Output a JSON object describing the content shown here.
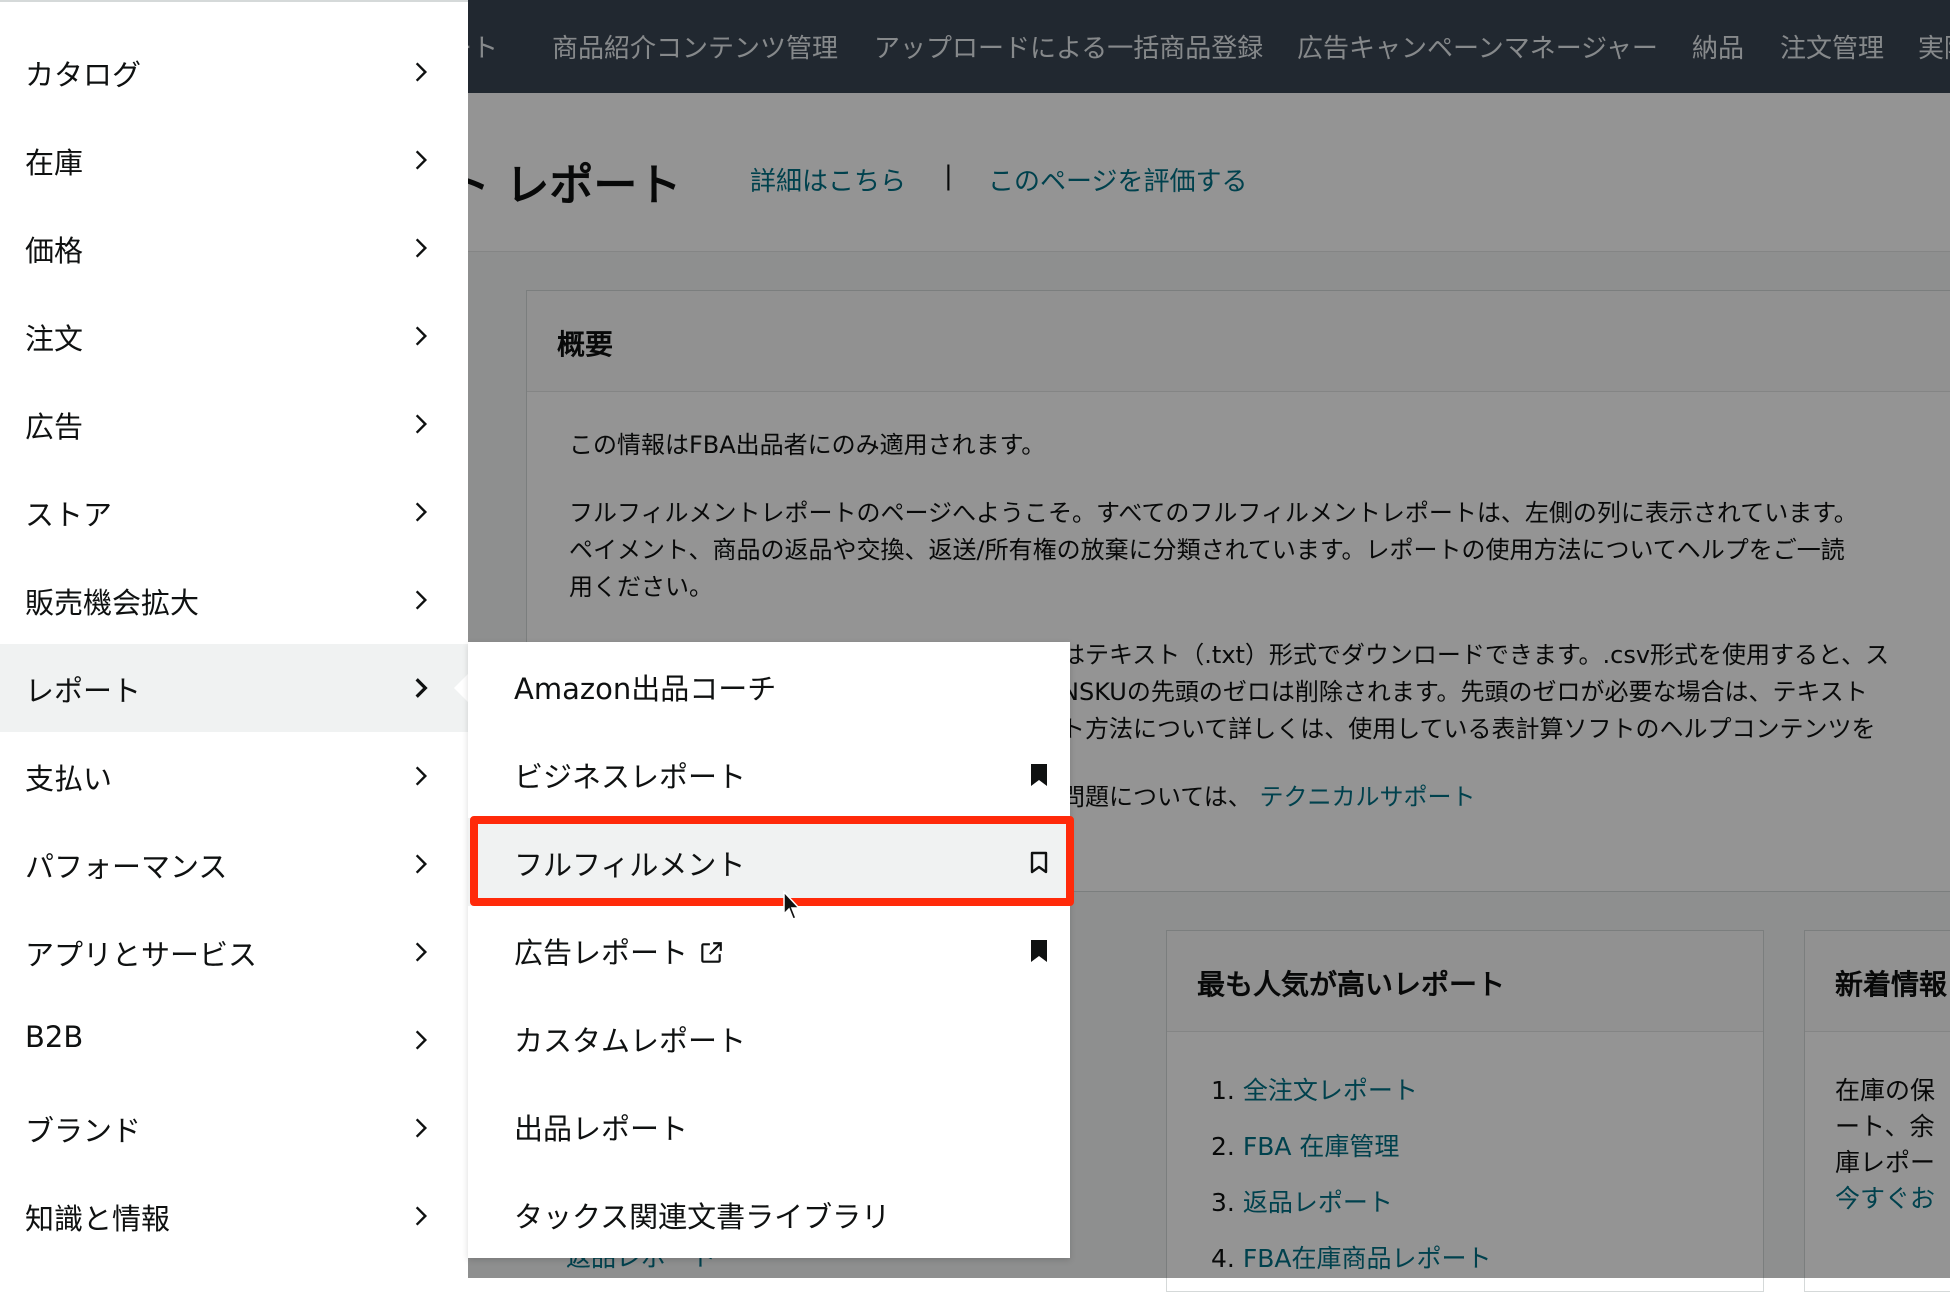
{
  "topnav": {
    "items": [
      "ート",
      "商品紹介コンテンツ管理",
      "アップロードによる一括商品登録",
      "広告キャンペーンマネージャー",
      "納品",
      "注文管理",
      "実際"
    ]
  },
  "header": {
    "title": "ト レポート",
    "learn_more": "詳細はこちら",
    "separator": "|",
    "rate_page": "このページを評価する"
  },
  "overview": {
    "title": "概要",
    "lines": [
      "この情報はFBA出品者にのみ適用されます。",
      "フルフィルメントレポートのページへようこそ。すべてのフルフィルメントレポートは、左側の列に表示されています。",
      "ペイメント、商品の返品や交換、返送/所有権の放棄に分類されています。レポートの使用方法についてヘルプをご一読",
      "用ください。",
      "はテキスト（.txt）形式でダウンロードできます。.csv形式を使用すると、ス",
      "NSKUの先頭のゼロは削除されます。先頭のゼロが必要な場合は、テキスト",
      "ト方法について詳しくは、使用している表計算ソフトのヘルプコンテンツを",
      "問題については、"
    ],
    "tech_support": "テクニカルサポート"
  },
  "popular": {
    "title": "最も人気が高いレポート",
    "items": [
      {
        "num": "1.",
        "label": "全注文レポート"
      },
      {
        "num": "2.",
        "label": "FBA 在庫管理"
      },
      {
        "num": "3.",
        "label": "返品レポート"
      },
      {
        "num": "4.",
        "label": "FBA在庫商品レポート"
      }
    ]
  },
  "news": {
    "title": "新着情報",
    "lines": [
      "在庫の保",
      "ート、余",
      "庫レポー"
    ],
    "link": "今すぐお"
  },
  "bottom_partial_link": "返品レポート",
  "sidebar": {
    "items": [
      {
        "label": "カタログ"
      },
      {
        "label": "在庫"
      },
      {
        "label": "価格"
      },
      {
        "label": "注文"
      },
      {
        "label": "広告"
      },
      {
        "label": "ストア"
      },
      {
        "label": "販売機会拡大"
      },
      {
        "label": "レポート"
      },
      {
        "label": "支払い"
      },
      {
        "label": "パフォーマンス"
      },
      {
        "label": "アプリとサービス"
      },
      {
        "label": "B2B"
      },
      {
        "label": "ブランド"
      },
      {
        "label": "知識と情報"
      }
    ],
    "active_index": 7
  },
  "submenu": {
    "items": [
      {
        "label": "Amazon出品コーチ",
        "bookmark": "none"
      },
      {
        "label": "ビジネスレポート",
        "bookmark": "filled"
      },
      {
        "label": "フルフィルメント",
        "bookmark": "outline"
      },
      {
        "label": "広告レポート",
        "bookmark": "filled",
        "external": true
      },
      {
        "label": "カスタムレポート",
        "bookmark": "none"
      },
      {
        "label": "出品レポート",
        "bookmark": "none"
      },
      {
        "label": "タックス関連文書ライブラリ",
        "bookmark": "none"
      }
    ],
    "hover_index": 2
  },
  "colors": {
    "highlight": "#ff2a0a",
    "link": "#007185",
    "topnav": "#3a4553"
  }
}
